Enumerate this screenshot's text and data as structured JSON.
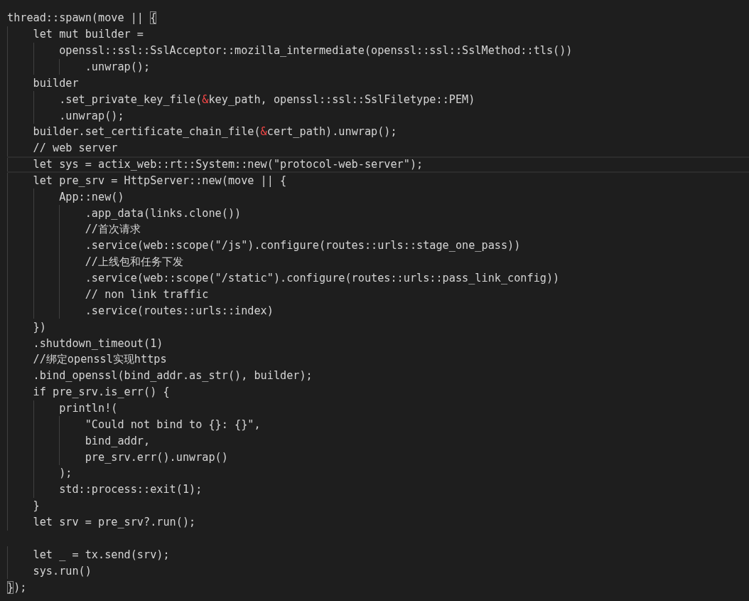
{
  "editor": {
    "lines": [
      {
        "segments": [
          {
            "text": "thread::spawn(move || ",
            "kind": "plain"
          },
          {
            "text": "{",
            "kind": "bracket-match"
          }
        ]
      },
      {
        "segments": [
          {
            "text": "    let mut builder =",
            "kind": "plain"
          }
        ]
      },
      {
        "segments": [
          {
            "text": "        openssl::ssl::SslAcceptor::mozilla_intermediate(openssl::ssl::SslMethod::tls())",
            "kind": "plain"
          }
        ]
      },
      {
        "segments": [
          {
            "text": "            .unwrap();",
            "kind": "plain"
          }
        ]
      },
      {
        "segments": [
          {
            "text": "    builder",
            "kind": "plain"
          }
        ]
      },
      {
        "segments": [
          {
            "text": "        .set_private_key_file(",
            "kind": "plain"
          },
          {
            "text": "&",
            "kind": "operator"
          },
          {
            "text": "key_path, openssl::ssl::SslFiletype::PEM)",
            "kind": "plain"
          }
        ]
      },
      {
        "segments": [
          {
            "text": "        .unwrap();",
            "kind": "plain"
          }
        ]
      },
      {
        "segments": [
          {
            "text": "    builder.set_certificate_chain_file(",
            "kind": "plain"
          },
          {
            "text": "&",
            "kind": "operator"
          },
          {
            "text": "cert_path).unwrap();",
            "kind": "plain"
          }
        ]
      },
      {
        "segments": [
          {
            "text": "    // web server",
            "kind": "plain"
          }
        ]
      },
      {
        "current": true,
        "segments": [
          {
            "text": "    let sys = actix_web::rt::System::new(\"protocol-web-server\");",
            "kind": "plain"
          }
        ]
      },
      {
        "segments": [
          {
            "text": "    let pre_srv = HttpServer::new(move || {",
            "kind": "plain"
          }
        ]
      },
      {
        "segments": [
          {
            "text": "        App::new()",
            "kind": "plain"
          }
        ]
      },
      {
        "segments": [
          {
            "text": "            .app_data(links.clone())",
            "kind": "plain"
          }
        ]
      },
      {
        "segments": [
          {
            "text": "            //首次请求",
            "kind": "plain"
          }
        ]
      },
      {
        "segments": [
          {
            "text": "            .service(web::scope(\"/js\").configure(routes::urls::stage_one_pass))",
            "kind": "plain"
          }
        ]
      },
      {
        "segments": [
          {
            "text": "            //上线包和任务下发",
            "kind": "plain"
          }
        ]
      },
      {
        "segments": [
          {
            "text": "            .service(web::scope(\"/static\").configure(routes::urls::pass_link_config))",
            "kind": "plain"
          }
        ]
      },
      {
        "segments": [
          {
            "text": "            // non link traffic",
            "kind": "plain"
          }
        ]
      },
      {
        "segments": [
          {
            "text": "            .service(routes::urls::index)",
            "kind": "plain"
          }
        ]
      },
      {
        "segments": [
          {
            "text": "    })",
            "kind": "plain"
          }
        ]
      },
      {
        "segments": [
          {
            "text": "    .shutdown_timeout(1)",
            "kind": "plain"
          }
        ]
      },
      {
        "segments": [
          {
            "text": "    //绑定openssl实现https",
            "kind": "plain"
          }
        ]
      },
      {
        "segments": [
          {
            "text": "    .bind_openssl(bind_addr.as_str(), builder);",
            "kind": "plain"
          }
        ]
      },
      {
        "segments": [
          {
            "text": "    if pre_srv.is_err() {",
            "kind": "plain"
          }
        ]
      },
      {
        "segments": [
          {
            "text": "        println!(",
            "kind": "plain"
          }
        ]
      },
      {
        "segments": [
          {
            "text": "            \"Could not bind to {}: {}\",",
            "kind": "plain"
          }
        ]
      },
      {
        "segments": [
          {
            "text": "            bind_addr,",
            "kind": "plain"
          }
        ]
      },
      {
        "segments": [
          {
            "text": "            pre_srv.err().unwrap()",
            "kind": "plain"
          }
        ]
      },
      {
        "segments": [
          {
            "text": "        );",
            "kind": "plain"
          }
        ]
      },
      {
        "segments": [
          {
            "text": "        std::process::exit(1);",
            "kind": "plain"
          }
        ]
      },
      {
        "segments": [
          {
            "text": "    }",
            "kind": "plain"
          }
        ]
      },
      {
        "segments": [
          {
            "text": "    let srv = pre_srv?.run();",
            "kind": "plain"
          }
        ]
      },
      {
        "current": false
      },
      {
        "segments": [
          {
            "text": "    let _ = tx.send(srv);",
            "kind": "plain"
          }
        ]
      },
      {
        "segments": [
          {
            "text": "    sys.run()",
            "kind": "plain"
          }
        ]
      },
      {
        "segments": [
          {
            "text": "}",
            "kind": "bracket-match"
          },
          {
            "text": ");",
            "kind": "plain"
          }
        ]
      }
    ]
  }
}
